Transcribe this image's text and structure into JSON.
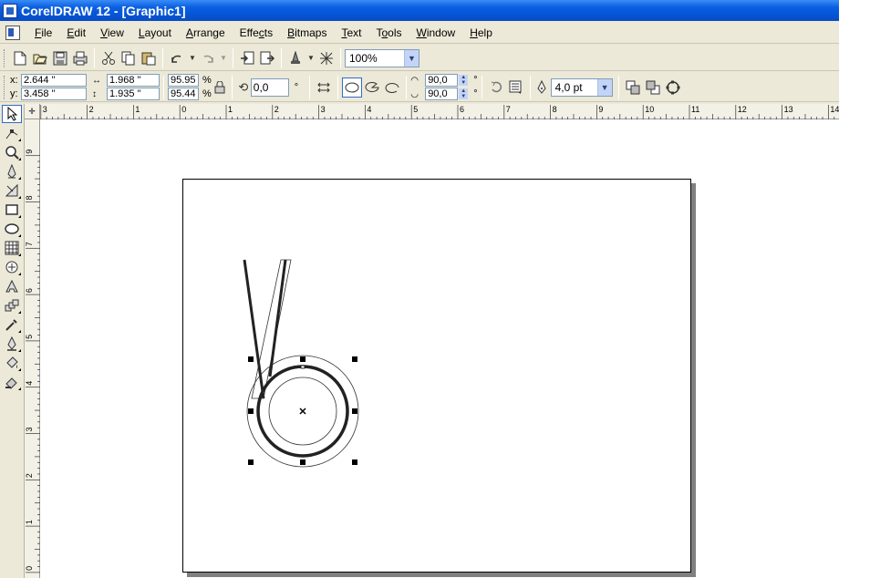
{
  "title": "CorelDRAW 12 - [Graphic1]",
  "menu": [
    "File",
    "Edit",
    "View",
    "Layout",
    "Arrange",
    "Effects",
    "Bitmaps",
    "Text",
    "Tools",
    "Window",
    "Help"
  ],
  "menu_accel": [
    "F",
    "E",
    "V",
    "L",
    "A",
    "c",
    "B",
    "T",
    "o",
    "W",
    "H"
  ],
  "standard_toolbar": {
    "zoom": "100%",
    "icons": [
      "new-icon",
      "open-icon",
      "save-icon",
      "print-icon",
      "cut-icon",
      "copy-icon",
      "paste-icon",
      "undo-icon",
      "redo-icon",
      "import-icon",
      "export-icon",
      "app-launcher-icon",
      "corel-online-icon"
    ]
  },
  "property_bar": {
    "x_label": "x:",
    "x": "2.644 \"",
    "y_label": "y:",
    "y": "3.458 \"",
    "width": "1.968 \"",
    "height": "1.935 \"",
    "scale_x": "95.95",
    "scale_y": "95.44",
    "percent": "%",
    "angle": "0,0",
    "degree": "°",
    "arc_start": "90,0",
    "arc_end": "90,0",
    "outline_width": "4,0 pt"
  },
  "ruler": {
    "h_ticks": [
      "3",
      "2",
      "1",
      "0",
      "1",
      "2",
      "3",
      "4",
      "5",
      "6",
      "7",
      "8",
      "9",
      "10",
      "11",
      "12",
      "13",
      "14"
    ],
    "v_ticks": [
      "9",
      "8",
      "7",
      "6",
      "5",
      "4",
      "3",
      "2",
      "1",
      "0"
    ]
  },
  "toolbox": [
    "pick-tool-icon",
    "shape-tool-icon",
    "zoom-tool-icon",
    "freehand-tool-icon",
    "smart-fill-tool-icon",
    "rectangle-tool-icon",
    "ellipse-tool-icon",
    "graph-paper-tool-icon",
    "basic-shapes-tool-icon",
    "text-tool-icon",
    "interactive-blend-tool-icon",
    "eyedropper-tool-icon",
    "outline-tool-icon",
    "fill-tool-icon",
    "interactive-fill-tool-icon"
  ],
  "colors": {
    "titlebar": "#0556d8",
    "ui_background": "#ece9d8",
    "page_shadow": "#808080"
  }
}
